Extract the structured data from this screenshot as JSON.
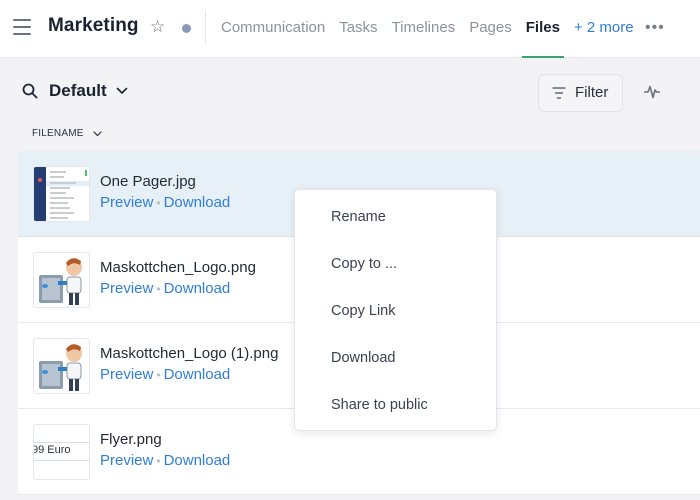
{
  "header": {
    "title": "Marketing",
    "tabs": [
      {
        "label": "Communication",
        "active": false
      },
      {
        "label": "Tasks",
        "active": false
      },
      {
        "label": "Timelines",
        "active": false
      },
      {
        "label": "Pages",
        "active": false
      },
      {
        "label": "Files",
        "active": true
      }
    ],
    "more_tabs_label": "+ 2 more",
    "overflow_label": "•••",
    "star_glyph": "☆",
    "accent_color": "#3aa26a",
    "link_color": "#2f7fd8"
  },
  "toolbar": {
    "view_name": "Default",
    "filter_label": "Filter"
  },
  "table": {
    "column_header": "FILENAME",
    "files": [
      {
        "name": "One Pager.jpg",
        "preview": "Preview",
        "download": "Download",
        "thumb": "document",
        "selected": true
      },
      {
        "name": "Maskottchen_Logo.png",
        "preview": "Preview",
        "download": "Download",
        "thumb": "mascot",
        "selected": false
      },
      {
        "name": "Maskottchen_Logo (1).png",
        "preview": "Preview",
        "download": "Download",
        "thumb": "mascot",
        "selected": false
      },
      {
        "name": "Flyer.png",
        "preview": "Preview",
        "download": "Download",
        "thumb": "flyer",
        "thumb_text": "99 Euro",
        "selected": false
      }
    ]
  },
  "context_menu": {
    "items": [
      "Rename",
      "Copy to ...",
      "Copy Link",
      "Download",
      "Share to public"
    ]
  }
}
